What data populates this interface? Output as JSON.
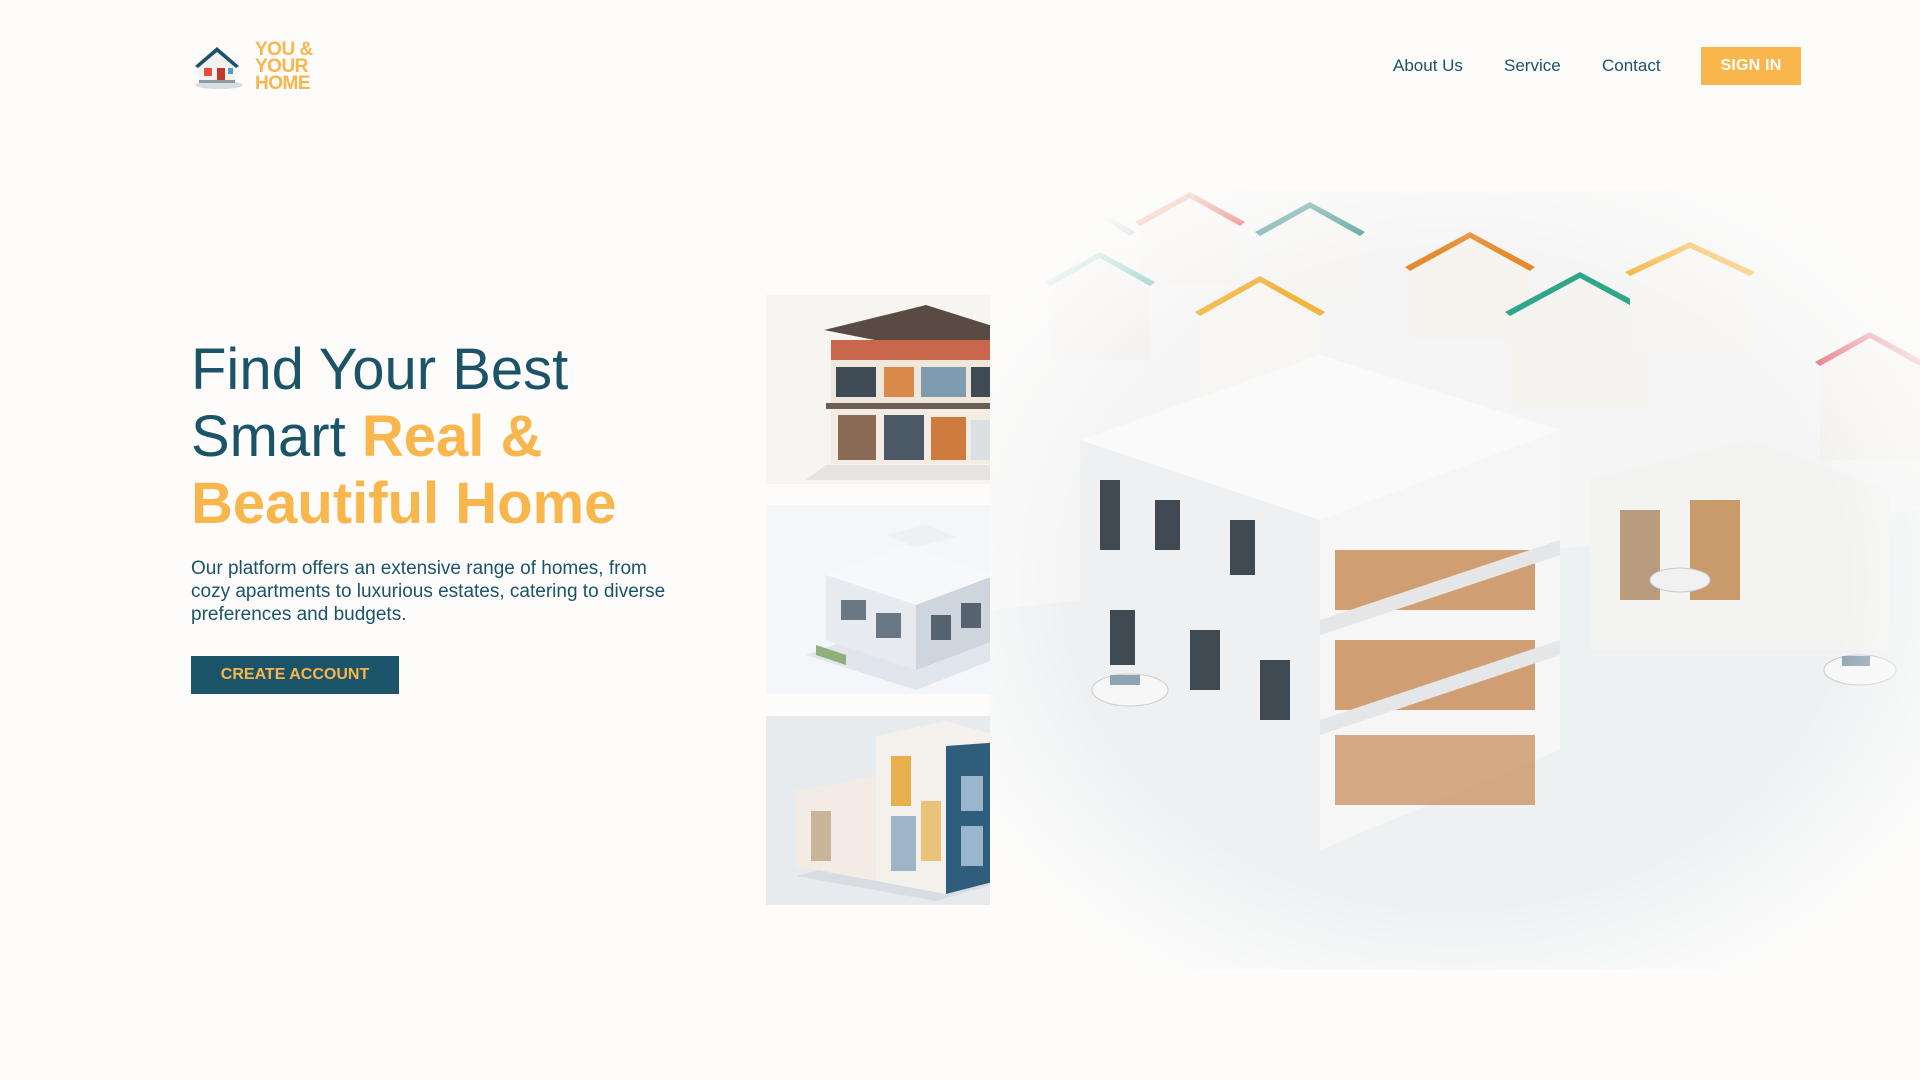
{
  "brand": {
    "logo_line1": "YOU &",
    "logo_line2": "YOUR",
    "logo_line3": "HOME",
    "logo_icon": "house-icon",
    "accent_color": "#f8b64c",
    "primary_color": "#1b5468"
  },
  "nav": {
    "items": [
      {
        "label": "About Us"
      },
      {
        "label": "Service"
      },
      {
        "label": "Contact"
      }
    ],
    "sign_in_label": "SIGN IN"
  },
  "hero": {
    "title_line1": "Find Your Best",
    "title_line2_plain": "Smart ",
    "title_line2_accent": "Real &",
    "title_line3_accent": "Beautiful Home",
    "description": "Our platform offers an extensive range of homes, from cozy apartments to luxurious estates, catering to diverse preferences and budgets.",
    "cta_label": "CREATE ACCOUNT"
  },
  "images": {
    "thumb1": "modern-house-image",
    "thumb2": "white-villa-image",
    "thumb3": "blue-townhouse-image",
    "main": "neighborhood-illustration"
  }
}
